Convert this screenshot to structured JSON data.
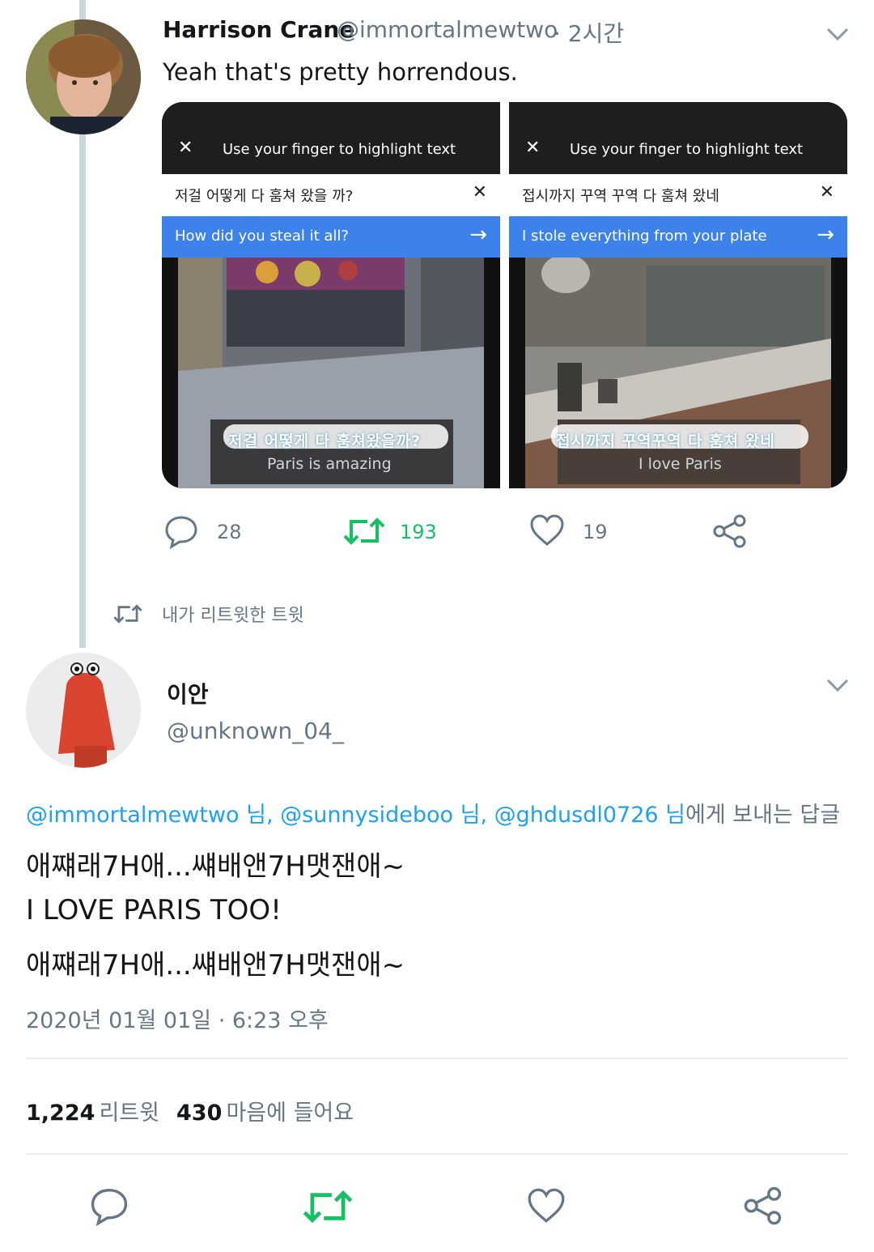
{
  "colors": {
    "accent": "#1da1f2",
    "retweet": "#17bf63",
    "muted": "#657786",
    "blue_bar": "#3d82ea"
  },
  "parent_tweet": {
    "name": "Harrison Crane",
    "handle": "@immortalmewtwo",
    "time": "· 2시간",
    "text": "Yeah that's pretty horrendous.",
    "media": [
      {
        "hint": "Use your finger to highlight text",
        "source_text": "저걸 어떻게 다 훔쳐 왔을 까?",
        "translation": "How did you steal it all?",
        "ocr_text": "저걸 어떻게 다 훔쳐왔을까?",
        "ocr_sub": "Paris is amazing"
      },
      {
        "hint": "Use your finger to highlight text",
        "source_text": "접시까지 꾸역 꾸역 다 훔쳐 왔네",
        "translation": "I stole everything from your plate",
        "ocr_text": "접시까지 꾸역꾸역 다 훔쳐 왔네",
        "ocr_sub": "I love Paris"
      }
    ],
    "actions": {
      "replies": "28",
      "retweets": "193",
      "likes": "19"
    }
  },
  "retweeted_label": "내가 리트윗한 트윗",
  "main_tweet": {
    "name": "이안",
    "handle": "@unknown_04_",
    "reply_to": {
      "mentions": [
        "@immortalmewtwo 님,",
        "@sunnysideboo 님,",
        "@ghdusdl0726 님"
      ],
      "suffix": "에게 보내는 답글"
    },
    "lines": [
      "애쨰래7H애...썌배앤7H맷잰애~",
      "I LOVE PARIS TOO!",
      "애쨰래7H애...썌배앤7H맷잰애~"
    ],
    "timestamp": "2020년 01월 01일 · 6:23 오후",
    "stats": {
      "retweets": "1,224",
      "retweets_label": "리트윗",
      "likes": "430",
      "likes_label": "마음에 들어요"
    }
  },
  "icons": [
    "reply-icon",
    "retweet-icon",
    "like-icon",
    "share-icon",
    "chevron-down-icon",
    "close-icon",
    "arrow-right-icon"
  ]
}
